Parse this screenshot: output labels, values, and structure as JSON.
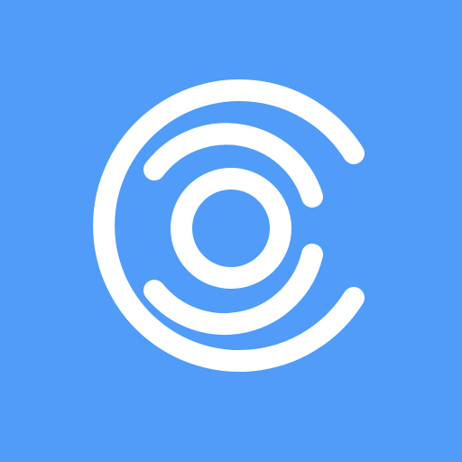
{
  "icon": {
    "name": "concentric-rings-logo-icon",
    "colors": {
      "background": "#509CF8",
      "foreground": "#FFFFFF"
    }
  }
}
